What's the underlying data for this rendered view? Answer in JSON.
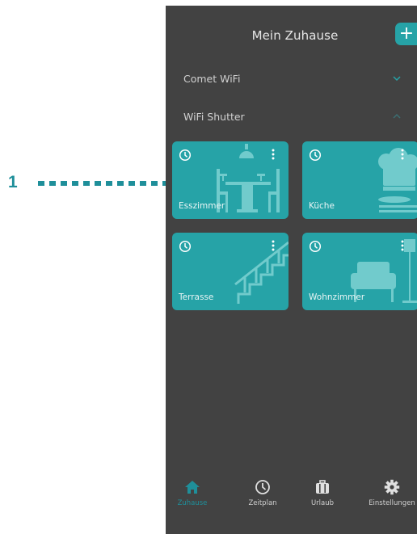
{
  "callout": {
    "number": "1"
  },
  "header": {
    "title": "Mein Zuhause",
    "add_label": "+"
  },
  "groups": [
    {
      "label": "Comet WiFi",
      "state": "collapsed"
    },
    {
      "label": "WiFi Shutter",
      "state": "expanded"
    }
  ],
  "rooms": [
    {
      "label": "Esszimmer",
      "icon": "dining-room-icon"
    },
    {
      "label": "Küche",
      "icon": "kitchen-icon"
    },
    {
      "label": "Terrasse",
      "icon": "stairs-icon"
    },
    {
      "label": "Wohnzimmer",
      "icon": "living-room-icon"
    }
  ],
  "nav": [
    {
      "label": "Zuhause",
      "icon": "home-icon",
      "active": true
    },
    {
      "label": "Zeitplan",
      "icon": "clock-icon",
      "active": false
    },
    {
      "label": "Urlaub",
      "icon": "suitcase-icon",
      "active": false
    },
    {
      "label": "Einstellungen",
      "icon": "gear-icon",
      "active": false
    }
  ],
  "colors": {
    "accent": "#26a3a7",
    "background": "#424242",
    "active_nav": "#1f8f9a"
  }
}
